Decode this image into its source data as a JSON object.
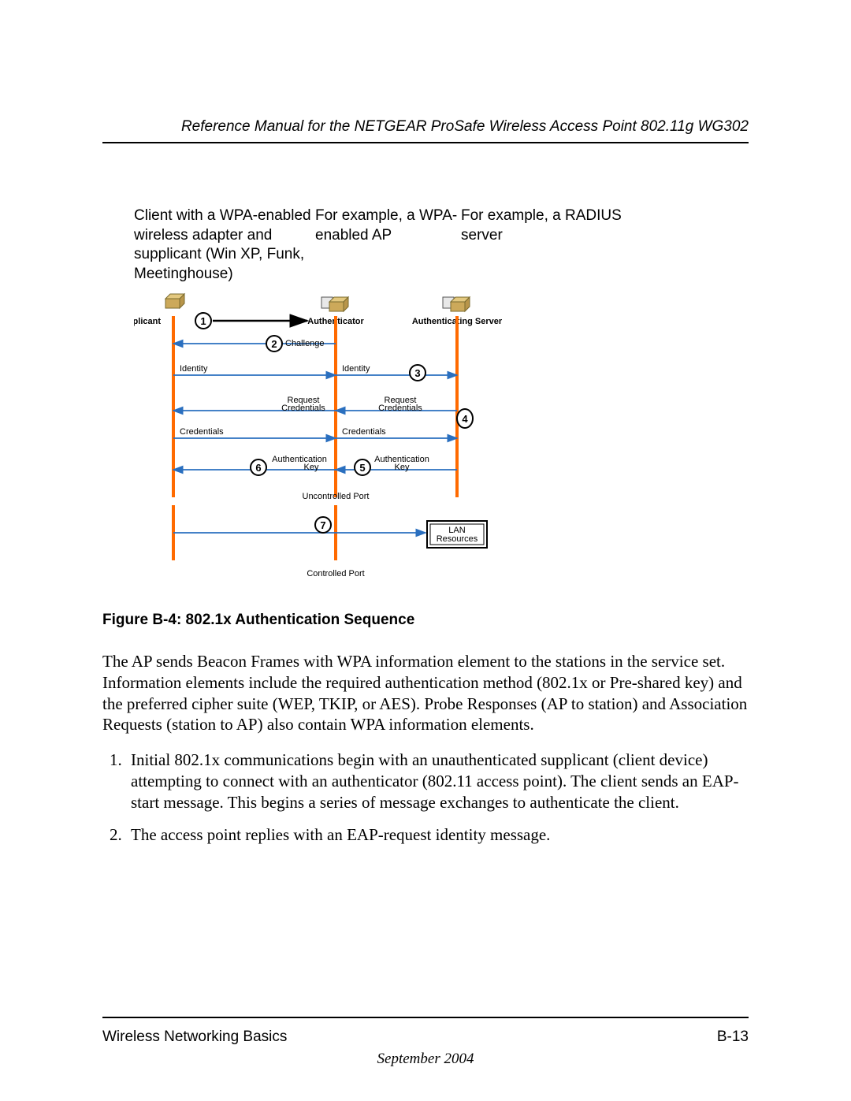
{
  "header": {
    "running_title": "Reference Manual for the NETGEAR ProSafe Wireless Access Point 802.11g WG302"
  },
  "annotations": {
    "col1": "Client with a WPA-enabled wireless adapter and supplicant (Win XP, Funk, Meetinghouse)",
    "col2": "For example, a WPA-enabled AP",
    "col3": "For example, a RADIUS server"
  },
  "diagram": {
    "actors": {
      "supplicant": "Supplicant",
      "authenticator": "Authenticator",
      "server": "Authenticating Server"
    },
    "steps": {
      "s1": "1",
      "s2": "2",
      "s3": "3",
      "s4": "4",
      "s5": "5",
      "s6": "6",
      "s7": "7"
    },
    "labels": {
      "challenge": "Challenge",
      "identity": "Identity",
      "request_cred_l1": "Request",
      "request_cred_l2": "Credentials",
      "credentials": "Credentials",
      "auth_key_l1": "Authentication",
      "auth_key_l2": "Key",
      "uncontrolled_port": "Uncontrolled Port",
      "controlled_port": "Controlled Port",
      "lan_l1": "LAN",
      "lan_l2": "Resources"
    }
  },
  "caption": "Figure B-4:  802.1x Authentication Sequence",
  "body": {
    "p1": "The AP sends Beacon Frames with WPA information element to the stations in the service set. Information elements include the required authentication method (802.1x or Pre-shared key) and the preferred cipher suite (WEP, TKIP, or AES). Probe Responses (AP to station) and Association Requests (station to AP) also contain WPA information elements.",
    "li1": "Initial 802.1x communications begin with an unauthenticated supplicant (client device) attempting to connect with an authenticator (802.11 access point). The client sends an EAP-start message. This begins a series of message exchanges to authenticate the client.",
    "li2": "The access point replies with an EAP-request identity message."
  },
  "footer": {
    "section": "Wireless Networking Basics",
    "page": "B-13",
    "date": "September 2004"
  }
}
